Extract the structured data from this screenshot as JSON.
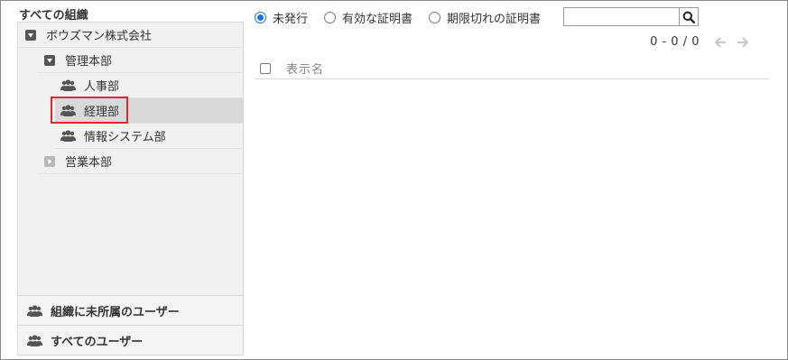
{
  "sidebar": {
    "title": "すべての組織",
    "tree": [
      {
        "label": "ボウズマン株式会社",
        "state": "expanded"
      },
      {
        "label": "管理本部",
        "state": "expanded"
      },
      {
        "label": "人事部",
        "icon": "group-icon"
      },
      {
        "label": "経理部",
        "icon": "group-icon",
        "selected": true
      },
      {
        "label": "情報システム部",
        "icon": "group-icon"
      },
      {
        "label": "営業本部",
        "state": "collapsed"
      }
    ],
    "bottom_items": [
      {
        "label": "組織に未所属のユーザー",
        "icon": "group-icon"
      },
      {
        "label": "すべてのユーザー",
        "icon": "group-icon"
      }
    ]
  },
  "filters": {
    "options": [
      {
        "label": "未発行",
        "checked": true
      },
      {
        "label": "有効な証明書",
        "checked": false
      },
      {
        "label": "期限切れの証明書",
        "checked": false
      }
    ]
  },
  "search": {
    "value": "",
    "icon": "search-icon"
  },
  "pager": {
    "text": "0 - 0 / 0"
  },
  "list": {
    "columns": [
      "表示名"
    ]
  },
  "colors": {
    "accent": "#1a73e8",
    "highlight": "#e0262b",
    "selected_bg": "#d9d9d9",
    "panel_bg": "#f1f1f1"
  }
}
